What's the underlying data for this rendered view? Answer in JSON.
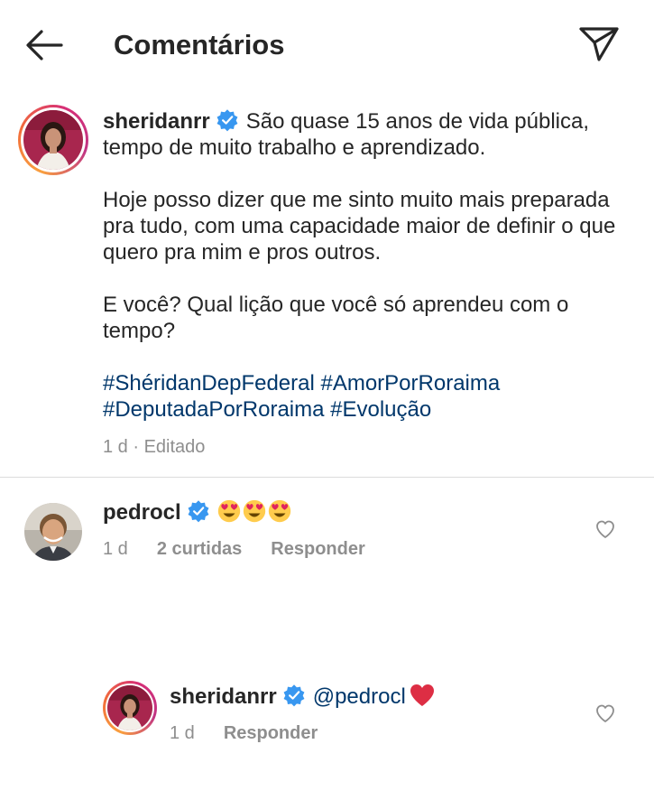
{
  "header": {
    "title": "Comentários",
    "back_icon": "arrow-left-icon",
    "send_icon": "paper-plane-icon"
  },
  "caption": {
    "username": "sheridanrr",
    "verified": true,
    "paragraph_1": "São quase 15 anos de vida pública, tempo de muito trabalho e aprendizado.",
    "paragraph_2": "Hoje posso dizer que me sinto muito mais preparada pra tudo, com uma capacidade maior de definir o que quero pra mim e pros outros.",
    "paragraph_3": "E você? Qual lição que você só aprendeu com o tempo?",
    "hashtags_line_1": "#ShéridanDepFederal #AmorPorRoraima",
    "hashtags_line_2": "#DeputadaPorRoraima #Evolução",
    "time": "1 d · Editado"
  },
  "comments": [
    {
      "username": "pedrocl",
      "verified": true,
      "emoji": [
        "smiling-face-with-heart-eyes",
        "smiling-face-with-heart-eyes",
        "smiling-face-with-heart-eyes"
      ],
      "time": "1 d",
      "likes": "2 curtidas",
      "reply_label": "Responder",
      "like_icon": "heart-outline-icon"
    }
  ],
  "replies": [
    {
      "username": "sheridanrr",
      "verified": true,
      "mention": "@pedrocl",
      "emoji": "red-heart",
      "time": "1 d",
      "reply_label": "Responder",
      "like_icon": "heart-outline-icon"
    }
  ],
  "colors": {
    "text": "#262626",
    "secondary": "#8e8e8e",
    "link": "#00376b",
    "verified": "#3897f0",
    "divider": "#dbdbdb",
    "heart": "#e0245e"
  }
}
